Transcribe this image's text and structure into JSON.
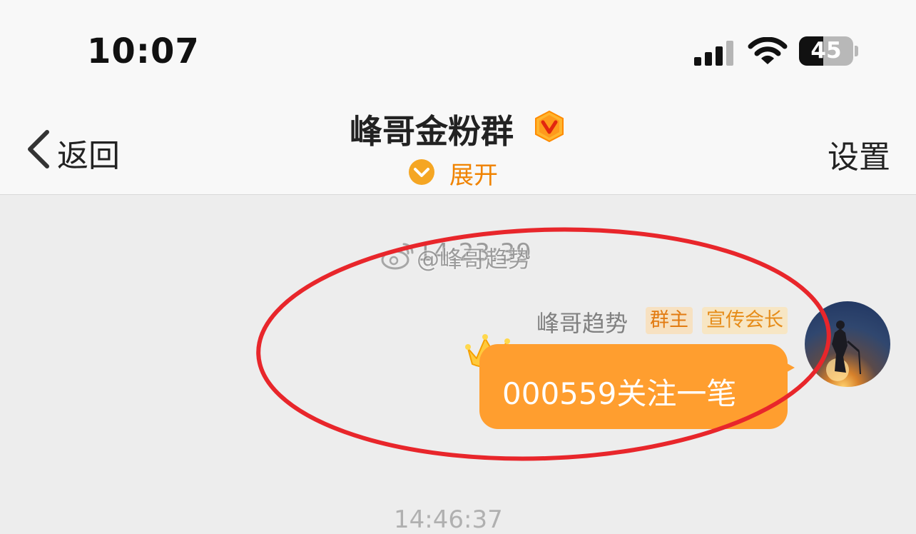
{
  "status_bar": {
    "time": "10:07",
    "battery_level": "45",
    "battery_fraction": 0.45,
    "icons": [
      "cellular-signal-icon",
      "wifi-icon",
      "battery-icon"
    ]
  },
  "nav": {
    "back_label": "返回",
    "title": "峰哥金粉群",
    "badge_icon": "vip-badge-icon",
    "expand_label": "展开",
    "settings_label": "设置"
  },
  "chat": {
    "timestamp": "14:23:39",
    "watermark": "@峰哥趋势",
    "messages": [
      {
        "sender": "峰哥趋势",
        "tags": [
          "群主",
          "宣传会长"
        ],
        "text": "000559关注一笔",
        "bubble_color": "#ff9e2f"
      }
    ],
    "next_timestamp": "14:46:37"
  },
  "colors": {
    "accent_orange": "#f08300",
    "bubble_orange": "#ff9e2f",
    "annotation_red": "#e8262b",
    "background": "#ededed"
  }
}
